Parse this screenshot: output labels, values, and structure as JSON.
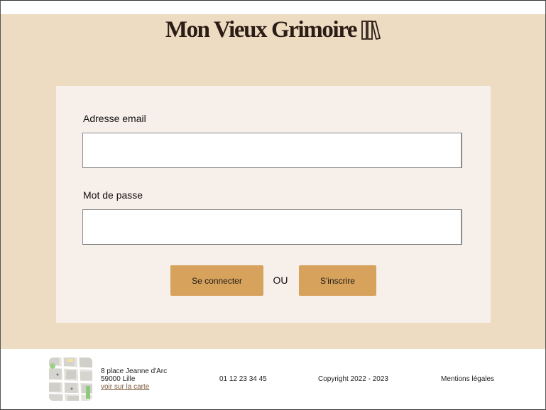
{
  "header": {
    "logo_text": "Mon Vieux Grimoire",
    "logo_icon": "books-icon"
  },
  "login_form": {
    "email_label": "Adresse email",
    "email_value": "",
    "email_placeholder": "",
    "password_label": "Mot de passe",
    "password_value": "",
    "password_placeholder": "",
    "login_button": "Se connecter",
    "or_text": "OU",
    "signup_button": "S'inscrire"
  },
  "footer": {
    "map_icon": "map-thumbnail",
    "address_line1": "8 place Jeanne d'Arc",
    "address_line2": "59000 Lille",
    "map_link": "voir sur la carte",
    "phone": "01 12 23 34 45",
    "copyright": "Copyright 2022 - 2023",
    "legal_link": "Mentions légales"
  },
  "colors": {
    "header_bg": "#eddcc2",
    "card_bg": "#f7efe9",
    "button_bg": "#d6a25c",
    "logo_color": "#2b1d16",
    "link_color": "#7d5a3c"
  }
}
